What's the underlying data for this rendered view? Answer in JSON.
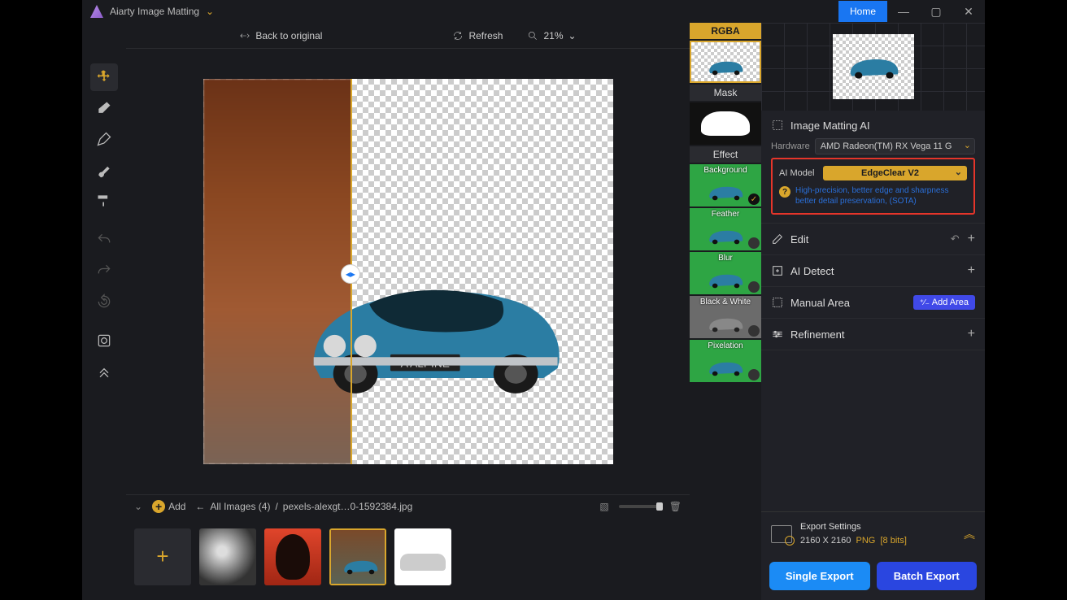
{
  "app": {
    "title": "Aiarty Image Matting"
  },
  "titlebar": {
    "home": "Home"
  },
  "toolbar": {
    "back_to_original": "Back to original",
    "refresh": "Refresh",
    "zoom": "21%"
  },
  "tabs": {
    "rgba": "RGBA",
    "mask": "Mask",
    "effect": "Effect"
  },
  "effects": {
    "background": "Background",
    "feather": "Feather",
    "blur": "Blur",
    "bw": "Black & White",
    "pixelation": "Pixelation"
  },
  "panel": {
    "title": "Image Matting AI",
    "hardware_label": "Hardware",
    "hardware_value": "AMD Radeon(TM) RX Vega 11 G",
    "ai_model_label": "AI Model",
    "ai_model_value": "EdgeClear  V2",
    "ai_model_desc": "High-precision, better edge and sharpness better detail preservation, (SOTA)",
    "edit": "Edit",
    "ai_detect": "AI Detect",
    "manual_area": "Manual Area",
    "add_area": "Add Area",
    "refinement": "Refinement"
  },
  "export": {
    "settings": "Export Settings",
    "resolution": "2160 X 2160",
    "format": "PNG",
    "bits": "[8 bits]",
    "single": "Single Export",
    "batch": "Batch Export"
  },
  "bottom": {
    "add": "Add",
    "back": "←",
    "all_images": "All Images (4)",
    "filename": "pexels-alexgt…0-1592384.jpg"
  }
}
